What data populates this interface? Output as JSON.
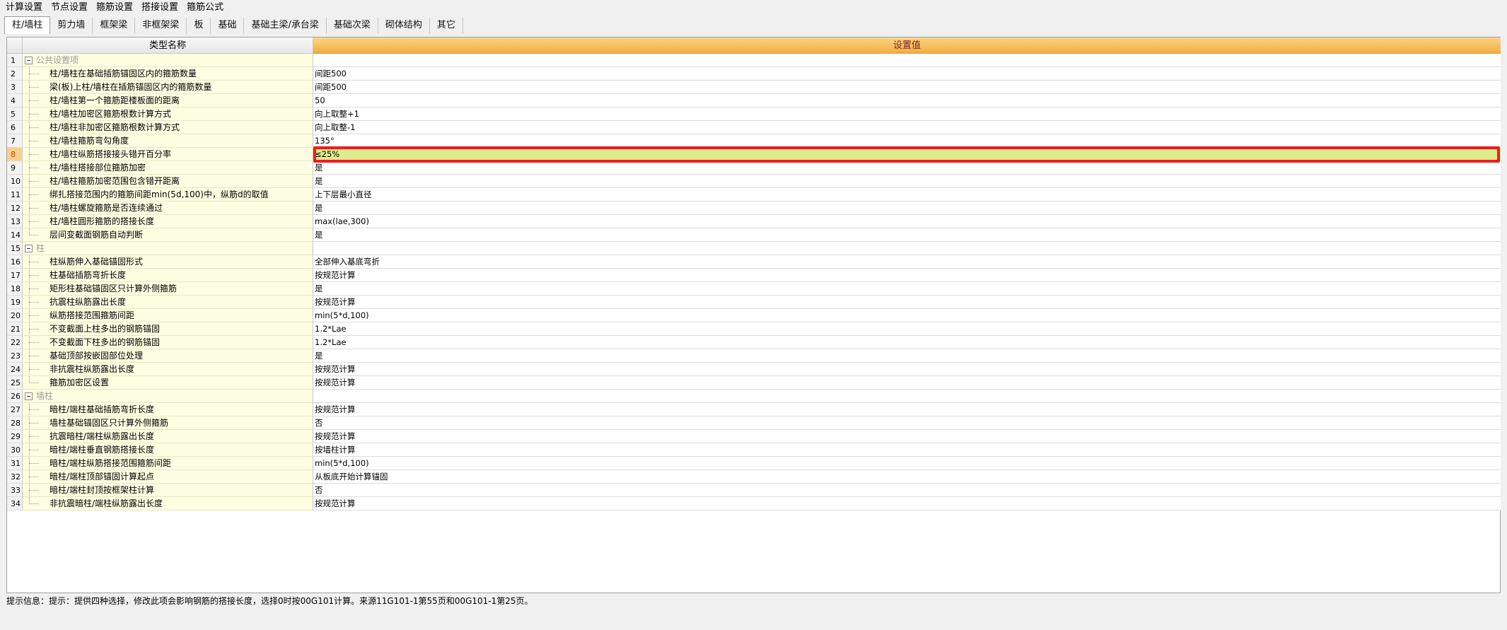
{
  "menu": [
    "计算设置",
    "节点设置",
    "箍筋设置",
    "搭接设置",
    "箍筋公式"
  ],
  "tabs": [
    {
      "label": "柱/墙柱",
      "active": true
    },
    {
      "label": "剪力墙",
      "active": false
    },
    {
      "label": "框架梁",
      "active": false
    },
    {
      "label": "非框架梁",
      "active": false
    },
    {
      "label": "板",
      "active": false
    },
    {
      "label": "基础",
      "active": false
    },
    {
      "label": "基础主梁/承台梁",
      "active": false
    },
    {
      "label": "基础次梁",
      "active": false
    },
    {
      "label": "砌体结构",
      "active": false
    },
    {
      "label": "其它",
      "active": false
    }
  ],
  "grid": {
    "header": {
      "name": "类型名称",
      "value": "设置值"
    },
    "rows": [
      {
        "num": "1",
        "name": "公共设置项",
        "value": "",
        "type": "group"
      },
      {
        "num": "2",
        "name": "柱/墙柱在基础插筋锚固区内的箍筋数量",
        "value": "间距500",
        "type": "child"
      },
      {
        "num": "3",
        "name": "梁(板)上柱/墙柱在插筋锚固区内的箍筋数量",
        "value": "间距500",
        "type": "child"
      },
      {
        "num": "4",
        "name": "柱/墙柱第一个箍筋距楼板面的距离",
        "value": "50",
        "type": "child"
      },
      {
        "num": "5",
        "name": "柱/墙柱加密区箍筋根数计算方式",
        "value": "向上取整+1",
        "type": "child"
      },
      {
        "num": "6",
        "name": "柱/墙柱非加密区箍筋根数计算方式",
        "value": "向上取整-1",
        "type": "child"
      },
      {
        "num": "7",
        "name": "柱/墙柱箍筋弯勾角度",
        "value": "135°",
        "type": "child"
      },
      {
        "num": "8",
        "name": "柱/墙柱纵筋搭接接头错开百分率",
        "value": "≤25%",
        "type": "child",
        "selected": true
      },
      {
        "num": "9",
        "name": "柱/墙柱搭接部位箍筋加密",
        "value": "是",
        "type": "child"
      },
      {
        "num": "10",
        "name": "柱/墙柱箍筋加密范围包含错开距离",
        "value": "是",
        "type": "child"
      },
      {
        "num": "11",
        "name": "绑扎搭接范围内的箍筋间距min(5d,100)中，纵筋d的取值",
        "value": "上下层最小直径",
        "type": "child"
      },
      {
        "num": "12",
        "name": "柱/墙柱螺旋箍筋是否连续通过",
        "value": "是",
        "type": "child"
      },
      {
        "num": "13",
        "name": "柱/墙柱圆形箍筋的搭接长度",
        "value": "max(lae,300)",
        "type": "child"
      },
      {
        "num": "14",
        "name": "层间变截面钢筋自动判断",
        "value": "是",
        "type": "child",
        "last": true
      },
      {
        "num": "15",
        "name": "柱",
        "value": "",
        "type": "group"
      },
      {
        "num": "16",
        "name": "柱纵筋伸入基础锚固形式",
        "value": "全部伸入基底弯折",
        "type": "child"
      },
      {
        "num": "17",
        "name": "柱基础插筋弯折长度",
        "value": "按规范计算",
        "type": "child"
      },
      {
        "num": "18",
        "name": "矩形柱基础锚固区只计算外侧箍筋",
        "value": "是",
        "type": "child"
      },
      {
        "num": "19",
        "name": "抗震柱纵筋露出长度",
        "value": "按规范计算",
        "type": "child"
      },
      {
        "num": "20",
        "name": "纵筋搭接范围箍筋间距",
        "value": "min(5*d,100)",
        "type": "child"
      },
      {
        "num": "21",
        "name": "不变截面上柱多出的钢筋锚固",
        "value": "1.2*Lae",
        "type": "child"
      },
      {
        "num": "22",
        "name": "不变截面下柱多出的钢筋锚固",
        "value": "1.2*Lae",
        "type": "child"
      },
      {
        "num": "23",
        "name": "基础顶部按嵌固部位处理",
        "value": "是",
        "type": "child"
      },
      {
        "num": "24",
        "name": "非抗震柱纵筋露出长度",
        "value": "按规范计算",
        "type": "child"
      },
      {
        "num": "25",
        "name": "箍筋加密区设置",
        "value": "按规范计算",
        "type": "child",
        "last": true
      },
      {
        "num": "26",
        "name": "墙柱",
        "value": "",
        "type": "group"
      },
      {
        "num": "27",
        "name": "暗柱/端柱基础插筋弯折长度",
        "value": "按规范计算",
        "type": "child"
      },
      {
        "num": "28",
        "name": "墙柱基础锚固区只计算外侧箍筋",
        "value": "否",
        "type": "child"
      },
      {
        "num": "29",
        "name": "抗震暗柱/端柱纵筋露出长度",
        "value": "按规范计算",
        "type": "child"
      },
      {
        "num": "30",
        "name": "暗柱/端柱垂直钢筋搭接长度",
        "value": "按墙柱计算",
        "type": "child"
      },
      {
        "num": "31",
        "name": "暗柱/端柱纵筋搭接范围箍筋间距",
        "value": "min(5*d,100)",
        "type": "child"
      },
      {
        "num": "32",
        "name": "暗柱/端柱顶部锚固计算起点",
        "value": "从板底开始计算锚固",
        "type": "child"
      },
      {
        "num": "33",
        "name": "暗柱/端柱封顶按框架柱计算",
        "value": "否",
        "type": "child"
      },
      {
        "num": "34",
        "name": "非抗震暗柱/端柱纵筋露出长度",
        "value": "按规范计算",
        "type": "child",
        "last": true
      }
    ]
  },
  "status": "提示信息：提示：提供四种选择，修改此项会影响钢筋的搭接长度，选择0时按00G101计算。来源11G101-1第55页和00G101-1第25页。"
}
